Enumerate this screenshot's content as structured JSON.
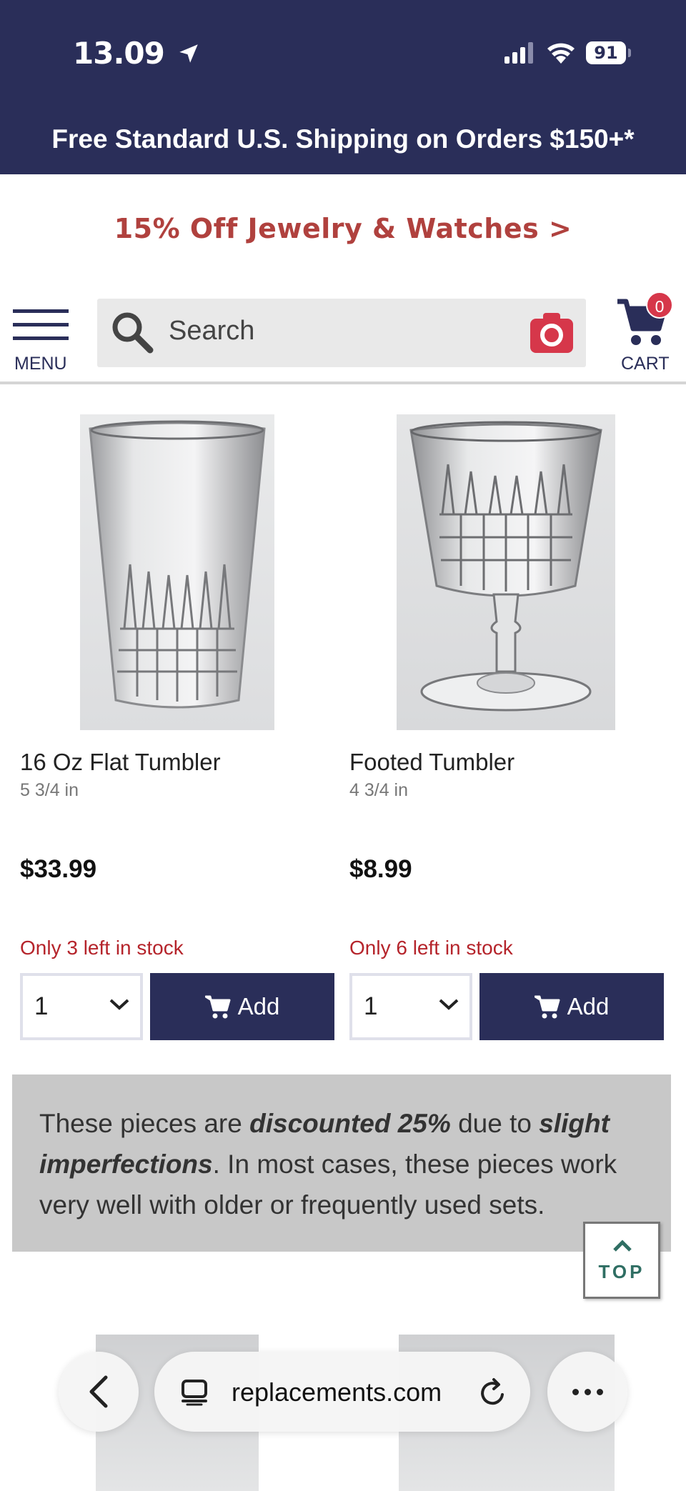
{
  "status_bar": {
    "time": "13.09",
    "battery": "91"
  },
  "banner": {
    "shipping": "Free Standard U.S. Shipping on Orders $150+*"
  },
  "promo": {
    "label": "15% Off Jewelry & Watches >"
  },
  "header": {
    "menu_label": "MENU",
    "search_placeholder": "Search",
    "cart_label": "CART",
    "cart_count": "0"
  },
  "products": [
    {
      "name": "16 Oz Flat Tumbler",
      "size": "5 3/4 in",
      "price": "$33.99",
      "stock": "Only 3 left in stock",
      "quantity": "1",
      "add_label": "Add"
    },
    {
      "name": "Footed Tumbler",
      "size": "4 3/4 in",
      "price": "$8.99",
      "stock": "Only 6 left in stock",
      "quantity": "1",
      "add_label": "Add"
    }
  ],
  "notice": {
    "text1": "These pieces are ",
    "emph1": "discounted 25%",
    "text2": " due to ",
    "emph2": "slight imperfections",
    "text3": ". In most cases, these pieces work very well with older or frequently used sets."
  },
  "top_button": {
    "label": "TOP"
  },
  "browser": {
    "url": "replacements.com"
  },
  "colors": {
    "navy": "#2a2e59",
    "promo_red": "#b0413e",
    "stock_red": "#b5242b",
    "badge_red": "#d6374a",
    "top_green": "#2f6e63"
  }
}
